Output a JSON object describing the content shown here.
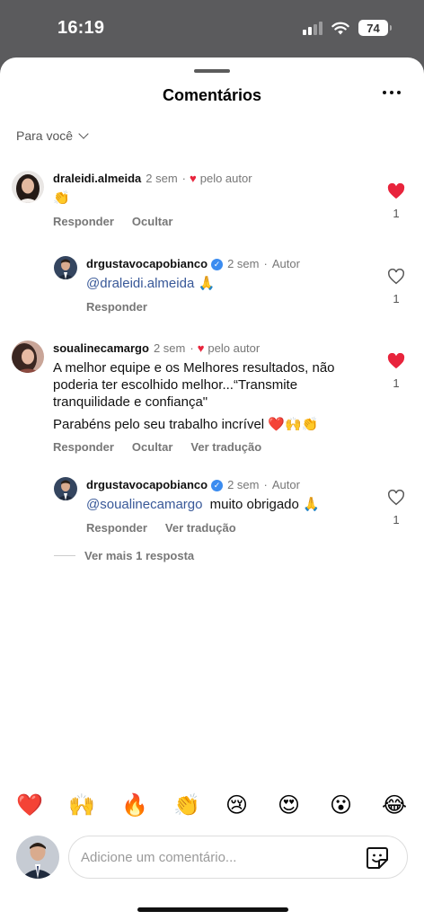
{
  "status_bar": {
    "time": "16:19",
    "battery": "74"
  },
  "sheet": {
    "title": "Comentários"
  },
  "filter": {
    "label": "Para você"
  },
  "comments": [
    {
      "user": "draleidi.almeida",
      "time": "2 sem",
      "liked_by_author": "pelo autor",
      "text": "👏",
      "actions": [
        "Responder",
        "Ocultar"
      ],
      "likes": "1",
      "liked": true
    },
    {
      "user": "drgustavocapobianco",
      "time": "2 sem",
      "role": "Autor",
      "mention": "@draleidi.almeida",
      "text": "🙏",
      "actions": [
        "Responder"
      ],
      "likes": "1",
      "liked": false
    },
    {
      "user": "soualinecamargo",
      "time": "2 sem",
      "liked_by_author": "pelo autor",
      "text_p1": "A melhor equipe e os Melhores resultados, não poderia ter escolhido melhor...“Transmite tranquilidade e confiança\"",
      "text_p2": "Parabéns pelo seu trabalho incrível ❤️🙌👏",
      "actions": [
        "Responder",
        "Ocultar",
        "Ver tradução"
      ],
      "likes": "1",
      "liked": true
    },
    {
      "user": "drgustavocapobianco",
      "time": "2 sem",
      "role": "Autor",
      "mention": "@soualinecamargo",
      "text": "muito obrigado 🙏",
      "actions": [
        "Responder",
        "Ver tradução"
      ],
      "likes": "1",
      "liked": false
    }
  ],
  "more_replies": "Ver mais 1 resposta",
  "quick_emojis": [
    "❤️",
    "🙌",
    "🔥",
    "👏",
    "😢",
    "😍",
    "😮",
    "😂"
  ],
  "composer": {
    "placeholder": "Adicione um comentário..."
  },
  "colors": {
    "like_red": "#e8243c",
    "mention_blue": "#385898",
    "verified_blue": "#3b8cf0"
  }
}
